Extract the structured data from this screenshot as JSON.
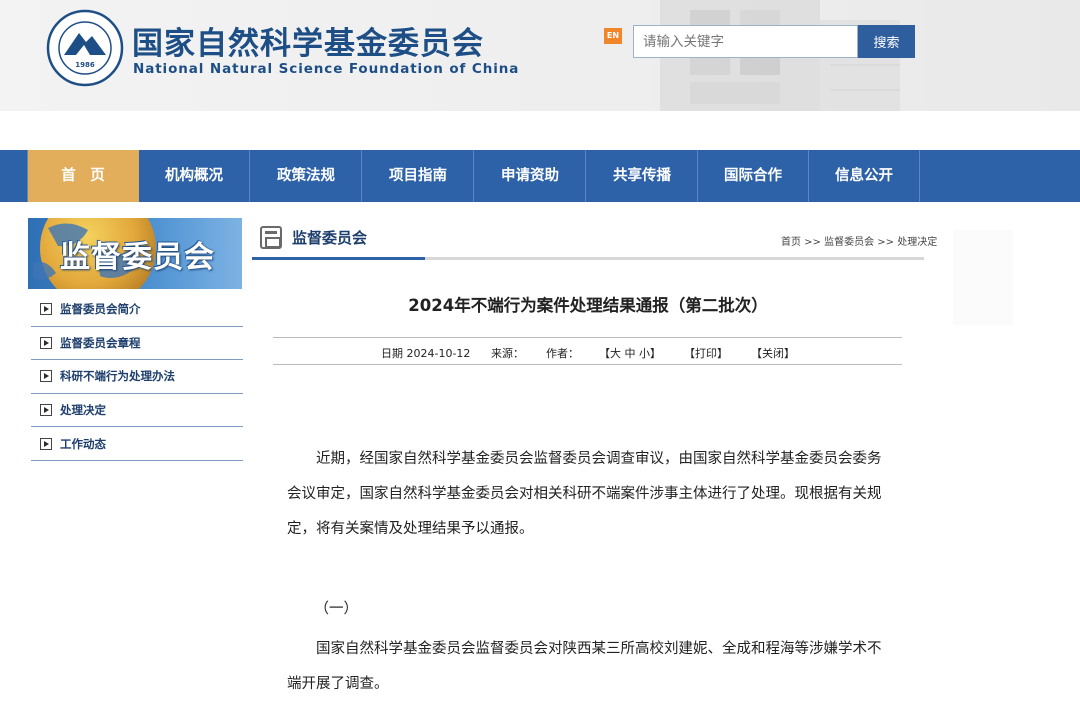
{
  "header": {
    "logo_year": "1986",
    "title_cn": "国家自然科学基金委员会",
    "title_en": "National Natural Science Foundation of China",
    "lang_badge": "EN",
    "search_placeholder": "请输入关键字",
    "search_button": "搜索"
  },
  "nav": {
    "items": [
      "首　页",
      "机构概况",
      "政策法规",
      "项目指南",
      "申请资助",
      "共享传播",
      "国际合作",
      "信息公开"
    ],
    "active_index": 0
  },
  "sidebar": {
    "banner": "监督委员会",
    "items": [
      "监督委员会简介",
      "监督委员会章程",
      "科研不端行为处理办法",
      "处理决定",
      "工作动态"
    ]
  },
  "section": {
    "title": "监督委员会",
    "breadcrumb": "首页 >> 监督委员会 >> 处理决定"
  },
  "article": {
    "title": "2024年不端行为案件处理结果通报（第二批次）",
    "meta": {
      "date": "日期 2024-10-12",
      "source": "来源：",
      "author": "作者：",
      "font_size": "【大 中 小】",
      "print": "【打印】",
      "close": "【关闭】"
    },
    "para1": "近期，经国家自然科学基金委员会监督委员会调查审议，由国家自然科学基金委员会委务会议审定，国家自然科学基金委员会对相关科研不端案件涉事主体进行了处理。现根据有关规定，将有关案情及处理结果予以通报。",
    "section_heading": "（一）",
    "para2": "国家自然科学基金委员会监督委员会对陕西某三所高校刘建妮、全成和程海等涉嫌学术不端开展了调查。"
  }
}
